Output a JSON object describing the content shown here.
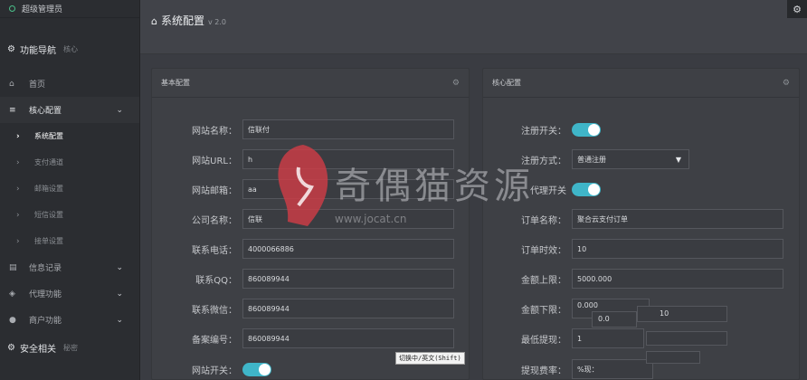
{
  "sidebar": {
    "user": "超级管理员",
    "section1": {
      "title": "功能导航",
      "sub": "核心"
    },
    "items": [
      {
        "label": "首页",
        "icon": "home-icon"
      },
      {
        "label": "核心配置",
        "icon": "sliders-icon"
      }
    ],
    "subitems": [
      "系统配置",
      "支付通道",
      "邮箱设置",
      "短信设置",
      "接单设置"
    ],
    "items2": [
      {
        "label": "信息记录",
        "icon": "list-icon"
      },
      {
        "label": "代理功能",
        "icon": "shield-icon"
      },
      {
        "label": "商户功能",
        "icon": "user-icon"
      }
    ],
    "section2": {
      "title": "安全相关",
      "sub": "秘密"
    }
  },
  "header": {
    "title": "系统配置",
    "version": "v 2.0"
  },
  "left_panel": {
    "title": "基本配置",
    "fields": [
      {
        "label": "网站名称：",
        "value": "信联付"
      },
      {
        "label": "网站URL：",
        "value": "h"
      },
      {
        "label": "网站邮箱：",
        "value": "aa"
      },
      {
        "label": "公司名称：",
        "value": "信联"
      },
      {
        "label": "联系电话：",
        "value": "4000066886"
      },
      {
        "label": "联系QQ：",
        "value": "860089944"
      },
      {
        "label": "联系微信：",
        "value": "860089944"
      },
      {
        "label": "备案编号：",
        "value": "860089944"
      }
    ],
    "toggle_label": "网站开关："
  },
  "right_panel": {
    "title": "核心配置",
    "reg_switch_label": "注册开关：",
    "reg_mode_label": "注册方式：",
    "reg_mode_value": "普通注册",
    "agent_label": "代理开关",
    "fields": [
      {
        "label": "订单名称：",
        "value": "聚合云支付订单"
      },
      {
        "label": "订单时效：",
        "value": "10"
      },
      {
        "label": "金额上限：",
        "value": "5000.000"
      },
      {
        "label": "金额下限：",
        "value": "0.000"
      }
    ],
    "min_extra": "0.0",
    "min_extra2": "10",
    "min_withdraw_label": "最低提现：",
    "min_withdraw_value": "1",
    "fee_label": "提现费率：",
    "fee_value": "%现："
  },
  "tooltip": "切换中/英文(Shift)",
  "watermark": {
    "text": "奇偶猫资源",
    "url": "www.jocat.cn"
  },
  "colors": {
    "accent": "#3fb5c8",
    "sidebar_bg": "#2b2d31",
    "panel_bg": "#3e4045"
  }
}
